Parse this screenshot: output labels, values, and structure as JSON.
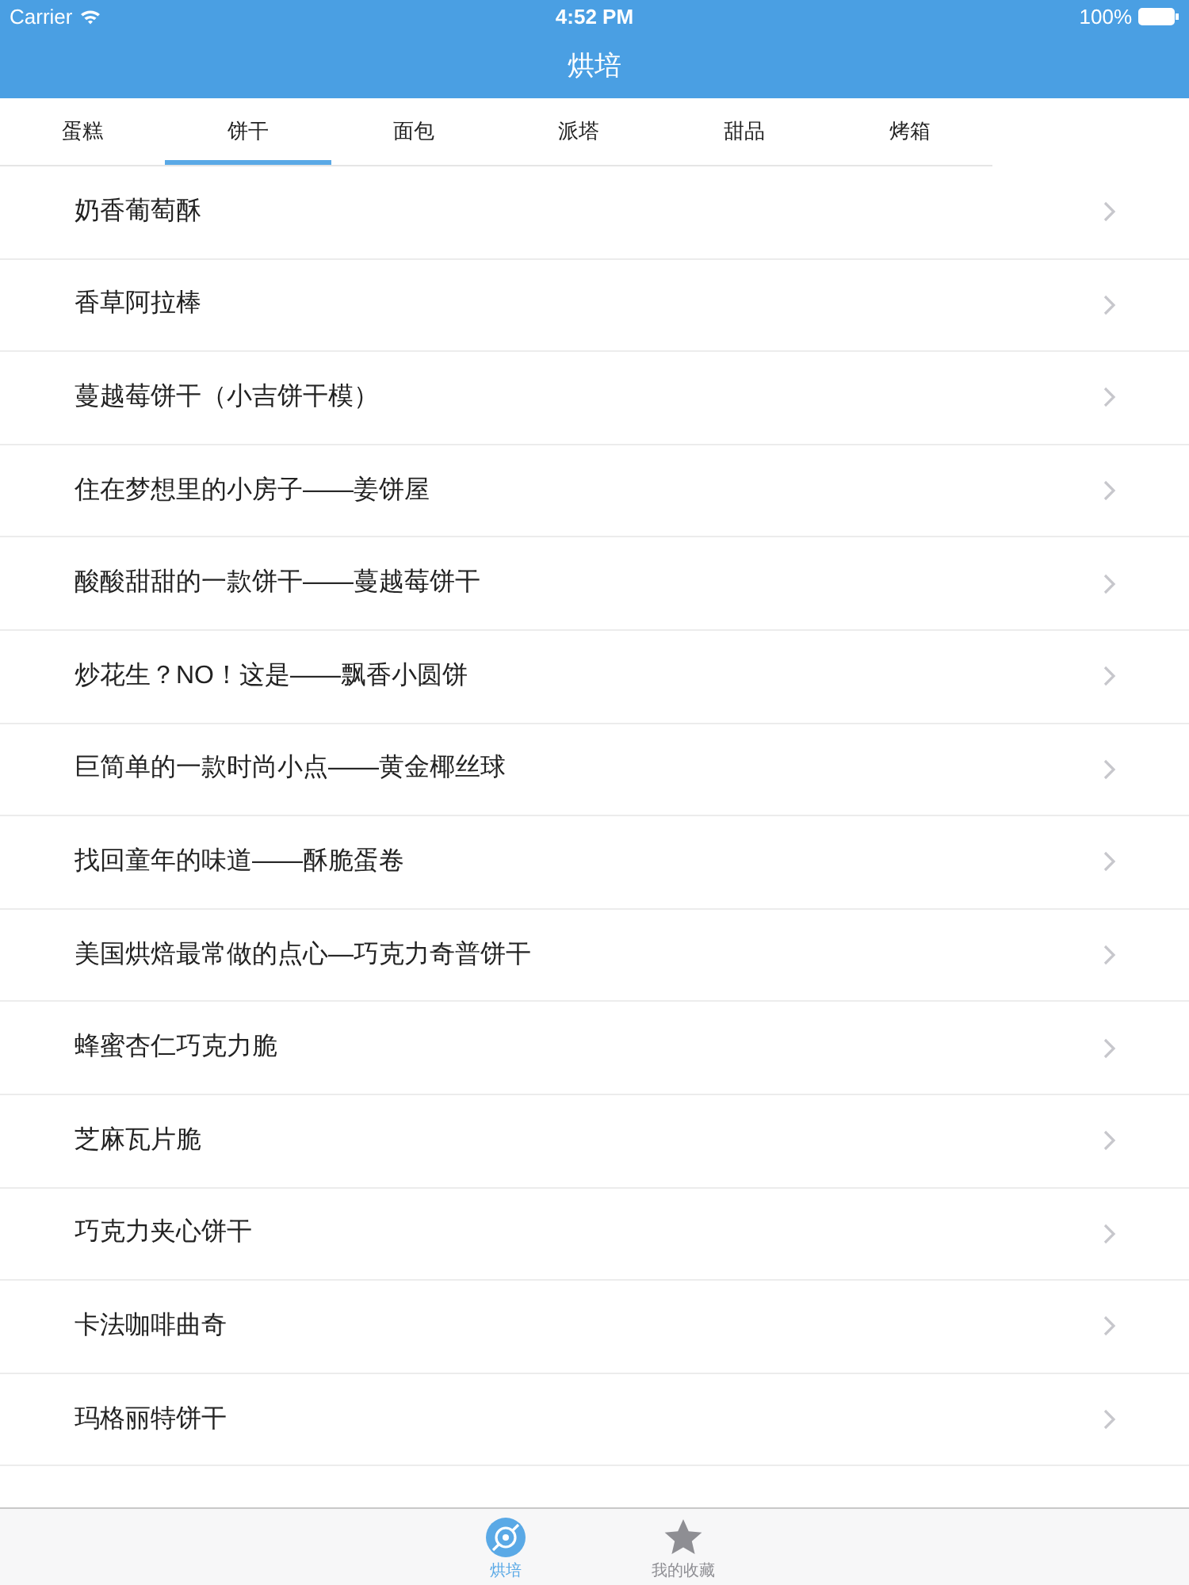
{
  "status_bar": {
    "carrier": "Carrier",
    "time": "4:52 PM",
    "battery": "100%"
  },
  "nav": {
    "title": "烘培"
  },
  "tabs": [
    {
      "label": "蛋糕",
      "selected": false
    },
    {
      "label": "饼干",
      "selected": true
    },
    {
      "label": "面包",
      "selected": false
    },
    {
      "label": "派塔",
      "selected": false
    },
    {
      "label": "甜品",
      "selected": false
    },
    {
      "label": "烤箱",
      "selected": false
    }
  ],
  "list": [
    {
      "title": "奶香葡萄酥"
    },
    {
      "title": "香草阿拉棒"
    },
    {
      "title": "蔓越莓饼干（小吉饼干模）"
    },
    {
      "title": "住在梦想里的小房子——姜饼屋"
    },
    {
      "title": "酸酸甜甜的一款饼干——蔓越莓饼干"
    },
    {
      "title": "炒花生？NO！这是——飘香小圆饼"
    },
    {
      "title": "巨简单的一款时尚小点——黄金椰丝球"
    },
    {
      "title": "找回童年的味道——酥脆蛋卷"
    },
    {
      "title": "美国烘焙最常做的点心—巧克力奇普饼干"
    },
    {
      "title": "蜂蜜杏仁巧克力脆"
    },
    {
      "title": "芝麻瓦片脆"
    },
    {
      "title": "巧克力夹心饼干"
    },
    {
      "title": "卡法咖啡曲奇"
    },
    {
      "title": "玛格丽特饼干"
    }
  ],
  "tab_bar": [
    {
      "label": "烘培",
      "selected": true
    },
    {
      "label": "我的收藏",
      "selected": false
    }
  ]
}
